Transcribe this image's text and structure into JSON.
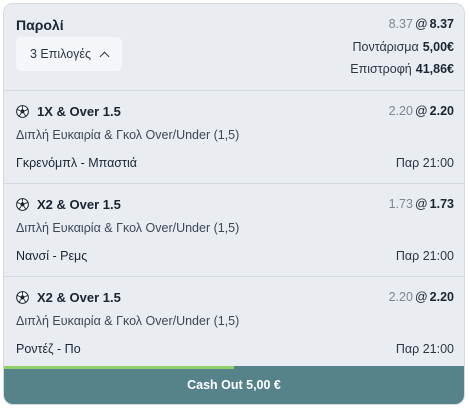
{
  "header": {
    "title": "Παρολί",
    "selections_label": "3 Επιλογές",
    "odds_old": "8.37",
    "odds_at": "@",
    "odds_new": "8.37",
    "stake_label": "Ποντάρισμα",
    "stake_value": "5,00€",
    "return_label": "Επιστροφή",
    "return_value": "41,86€"
  },
  "selections": [
    {
      "market": "1X & Over 1.5",
      "odds_old": "2.20",
      "odds_new": "2.20",
      "description": "Διπλή Ευκαιρία & Γκολ Over/Under (1,5)",
      "match": "Γκρενόμπλ - Μπαστιά",
      "time": "Παρ 21:00"
    },
    {
      "market": "X2 & Over 1.5",
      "odds_old": "1.73",
      "odds_new": "1.73",
      "description": "Διπλή Ευκαιρία & Γκολ Over/Under (1,5)",
      "match": "Νανσί - Ρεμς",
      "time": "Παρ 21:00"
    },
    {
      "market": "X2 & Over 1.5",
      "odds_old": "2.20",
      "odds_new": "2.20",
      "description": "Διπλή Ευκαιρία & Γκολ Over/Under (1,5)",
      "match": "Ροντέζ - Πο",
      "time": "Παρ 21:00"
    }
  ],
  "cashout": {
    "label": "Cash Out 5,00 €",
    "progress": 0.5
  },
  "colors": {
    "cashout_bg": "#56838a",
    "cashout_progress": "#8fd16b",
    "card_bg": "#e9edf2"
  },
  "icons": {
    "sport": "soccer-ball-icon",
    "toggle": "chevron-up-icon"
  }
}
